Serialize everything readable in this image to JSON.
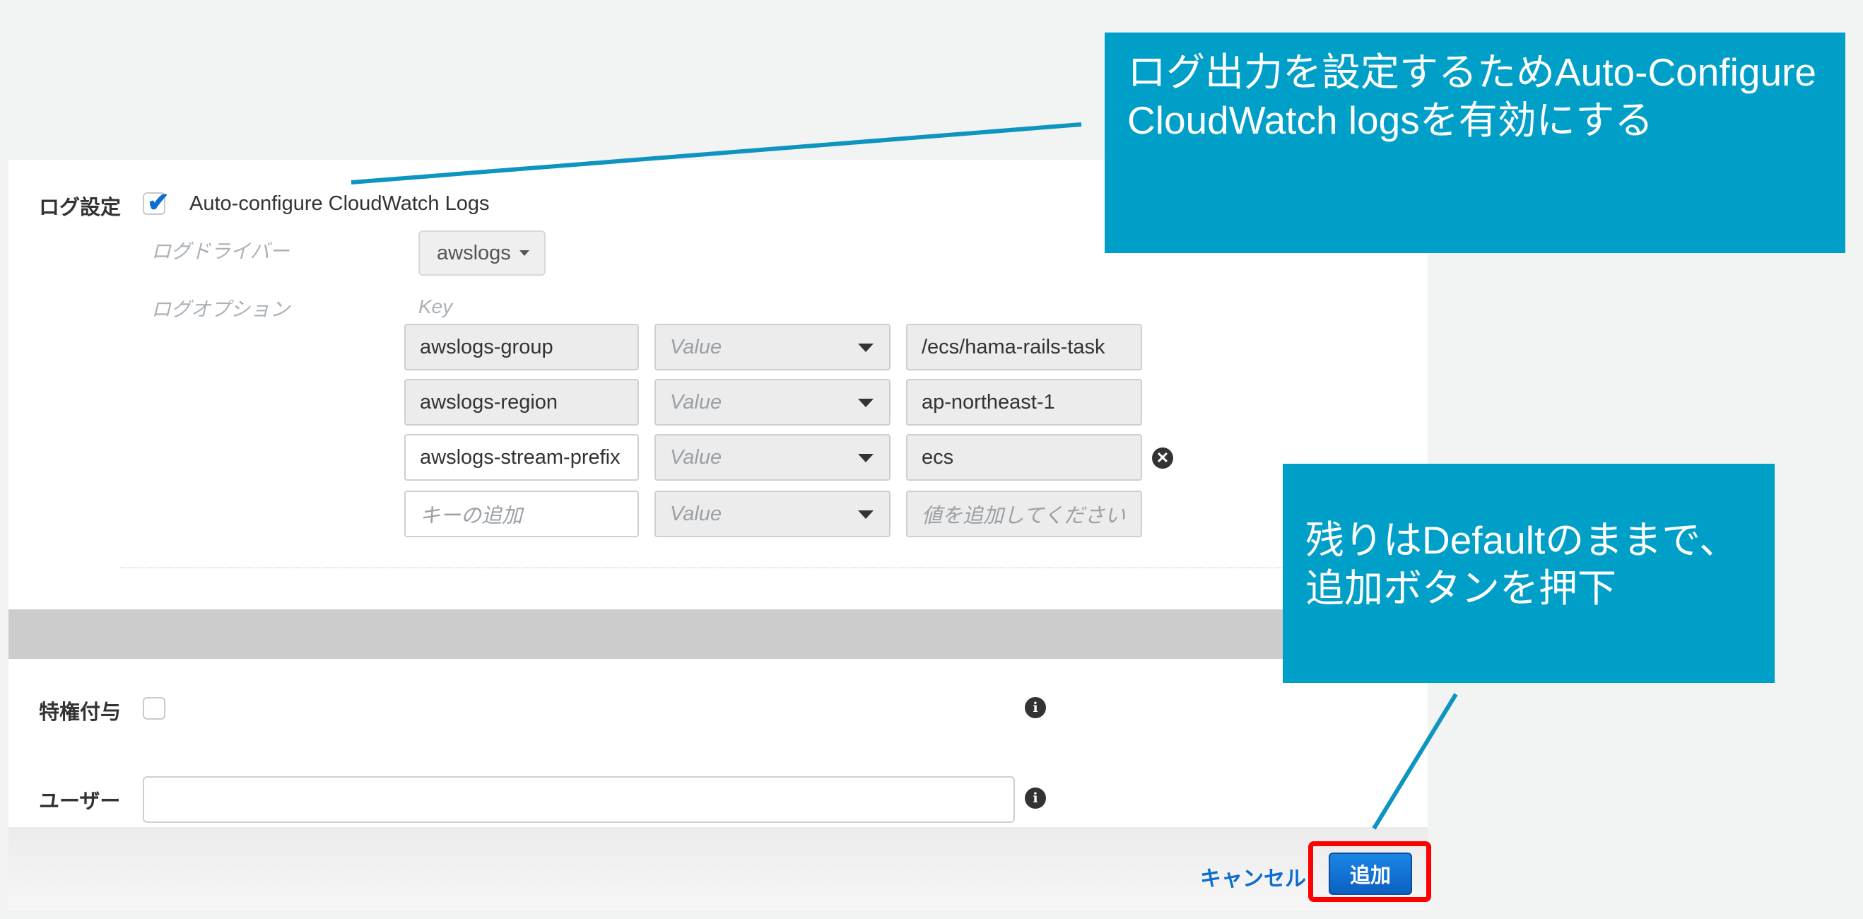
{
  "log_section": {
    "label": "ログ設定",
    "auto_configure_label": "Auto-configure CloudWatch Logs",
    "auto_configure_checked": true,
    "log_driver_label": "ログドライバー",
    "log_driver_value": "awslogs",
    "log_options_label": "ログオプション",
    "key_header": "Key",
    "options": [
      {
        "key": "awslogs-group",
        "type": "Value",
        "value": "/ecs/hama-rails-task"
      },
      {
        "key": "awslogs-region",
        "type": "Value",
        "value": "ap-northeast-1"
      },
      {
        "key": "awslogs-stream-prefix",
        "type": "Value",
        "value": "ecs"
      }
    ],
    "new_option": {
      "key_placeholder": "キーの追加",
      "type": "Value",
      "value_placeholder": "値を追加してください"
    }
  },
  "privilege": {
    "label": "特権付与",
    "checked": false
  },
  "user": {
    "label": "ユーザー",
    "value": ""
  },
  "footer": {
    "cancel_label": "キャンセル",
    "add_label": "追加"
  },
  "callouts": {
    "top": "ログ出力を設定するためAuto-Configure CloudWatch logsを有効にする",
    "bottom": "残りはDefaultのままで、追加ボタンを押下"
  },
  "colors": {
    "callout_bg": "#009fc8",
    "highlight": "#ff0000",
    "primary_button": "#0c6fd1",
    "link": "#0d6ecd"
  }
}
